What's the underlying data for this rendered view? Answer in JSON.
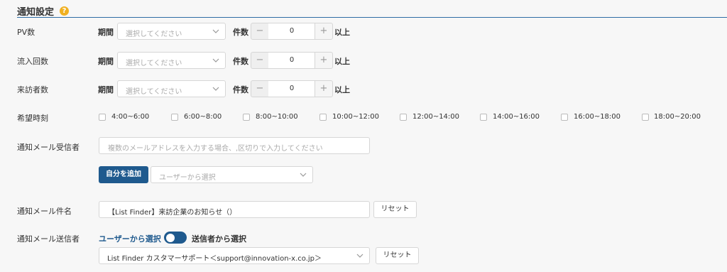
{
  "section": {
    "title": "通知設定",
    "help_icon": "?"
  },
  "period_label": "期間",
  "count_label": "件数",
  "suffix_label": "以上",
  "select_placeholder": "選択してください",
  "rows": [
    {
      "label": "PV数",
      "value": "0"
    },
    {
      "label": "流入回数",
      "value": "0"
    },
    {
      "label": "来訪者数",
      "value": "0"
    }
  ],
  "stepper": {
    "minus": "−",
    "plus": "+"
  },
  "time_slots": {
    "label": "希望時刻",
    "options": [
      "4:00~6:00",
      "6:00~8:00",
      "8:00~10:00",
      "10:00~12:00",
      "12:00~14:00",
      "14:00~16:00",
      "16:00~18:00",
      "18:00~20:00"
    ]
  },
  "recipients": {
    "label": "通知メール受信者",
    "placeholder": "複数のメールアドレスを入力する場合、,区切りで入力してください",
    "add_self_button": "自分を追加",
    "user_select_placeholder": "ユーザーから選択"
  },
  "subject": {
    "label": "通知メール件名",
    "value": "【List Finder】来訪企業のお知らせ（）",
    "reset_button": "リセット"
  },
  "sender": {
    "label": "通知メール送信者",
    "toggle_left": "ユーザーから選択",
    "toggle_right": "送信者から選択",
    "selected": "List Finder カスタマーサポート＜support@innovation-x.co.jp＞",
    "reset_button": "リセット"
  }
}
